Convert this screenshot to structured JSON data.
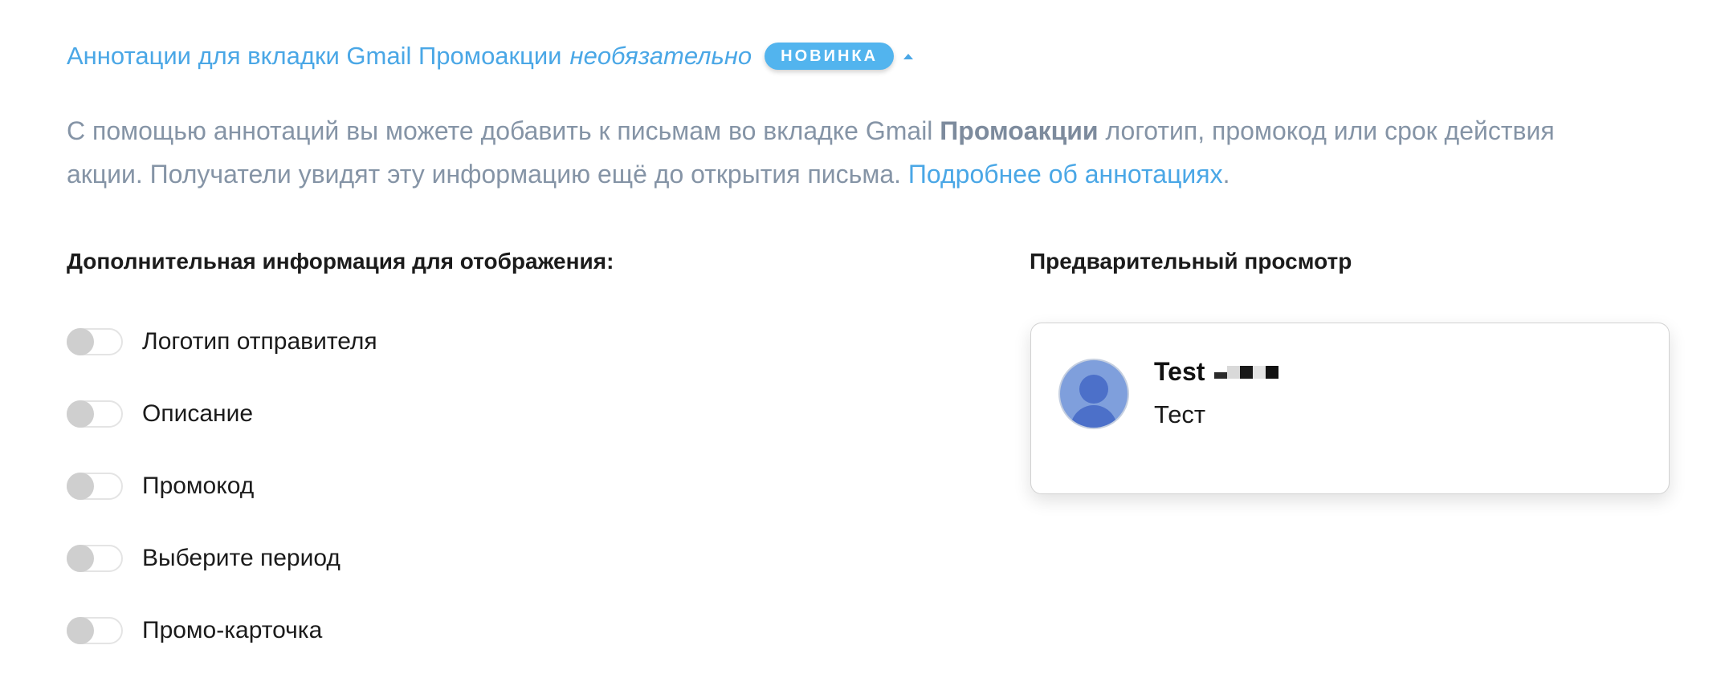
{
  "header": {
    "title": "Аннотации для вкладки Gmail Промоакции",
    "optional_label": "необязательно",
    "badge": "НОВИНКА"
  },
  "description": {
    "part1": "С помощью аннотаций вы можете добавить к письмам во вкладке Gmail ",
    "bold": "Промоакции",
    "part2": " логотип, промокод или срок действия акции. Получатели увидят эту информацию ещё до открытия письма. ",
    "link": "Подробнее об аннотациях",
    "end": "."
  },
  "left": {
    "heading": "Дополнительная информация для отображения:",
    "toggles": [
      {
        "label": "Логотип отправителя",
        "on": false
      },
      {
        "label": "Описание",
        "on": false
      },
      {
        "label": "Промокод",
        "on": false
      },
      {
        "label": "Выберите период",
        "on": false
      },
      {
        "label": "Промо-карточка",
        "on": false
      }
    ]
  },
  "preview": {
    "heading": "Предварительный просмотр",
    "sender": "Test",
    "subject": "Тест"
  },
  "colors": {
    "accent": "#4aa7e6",
    "badge": "#52b4ee",
    "muted_text": "#8594a6",
    "avatar": "#7f9fdc"
  }
}
